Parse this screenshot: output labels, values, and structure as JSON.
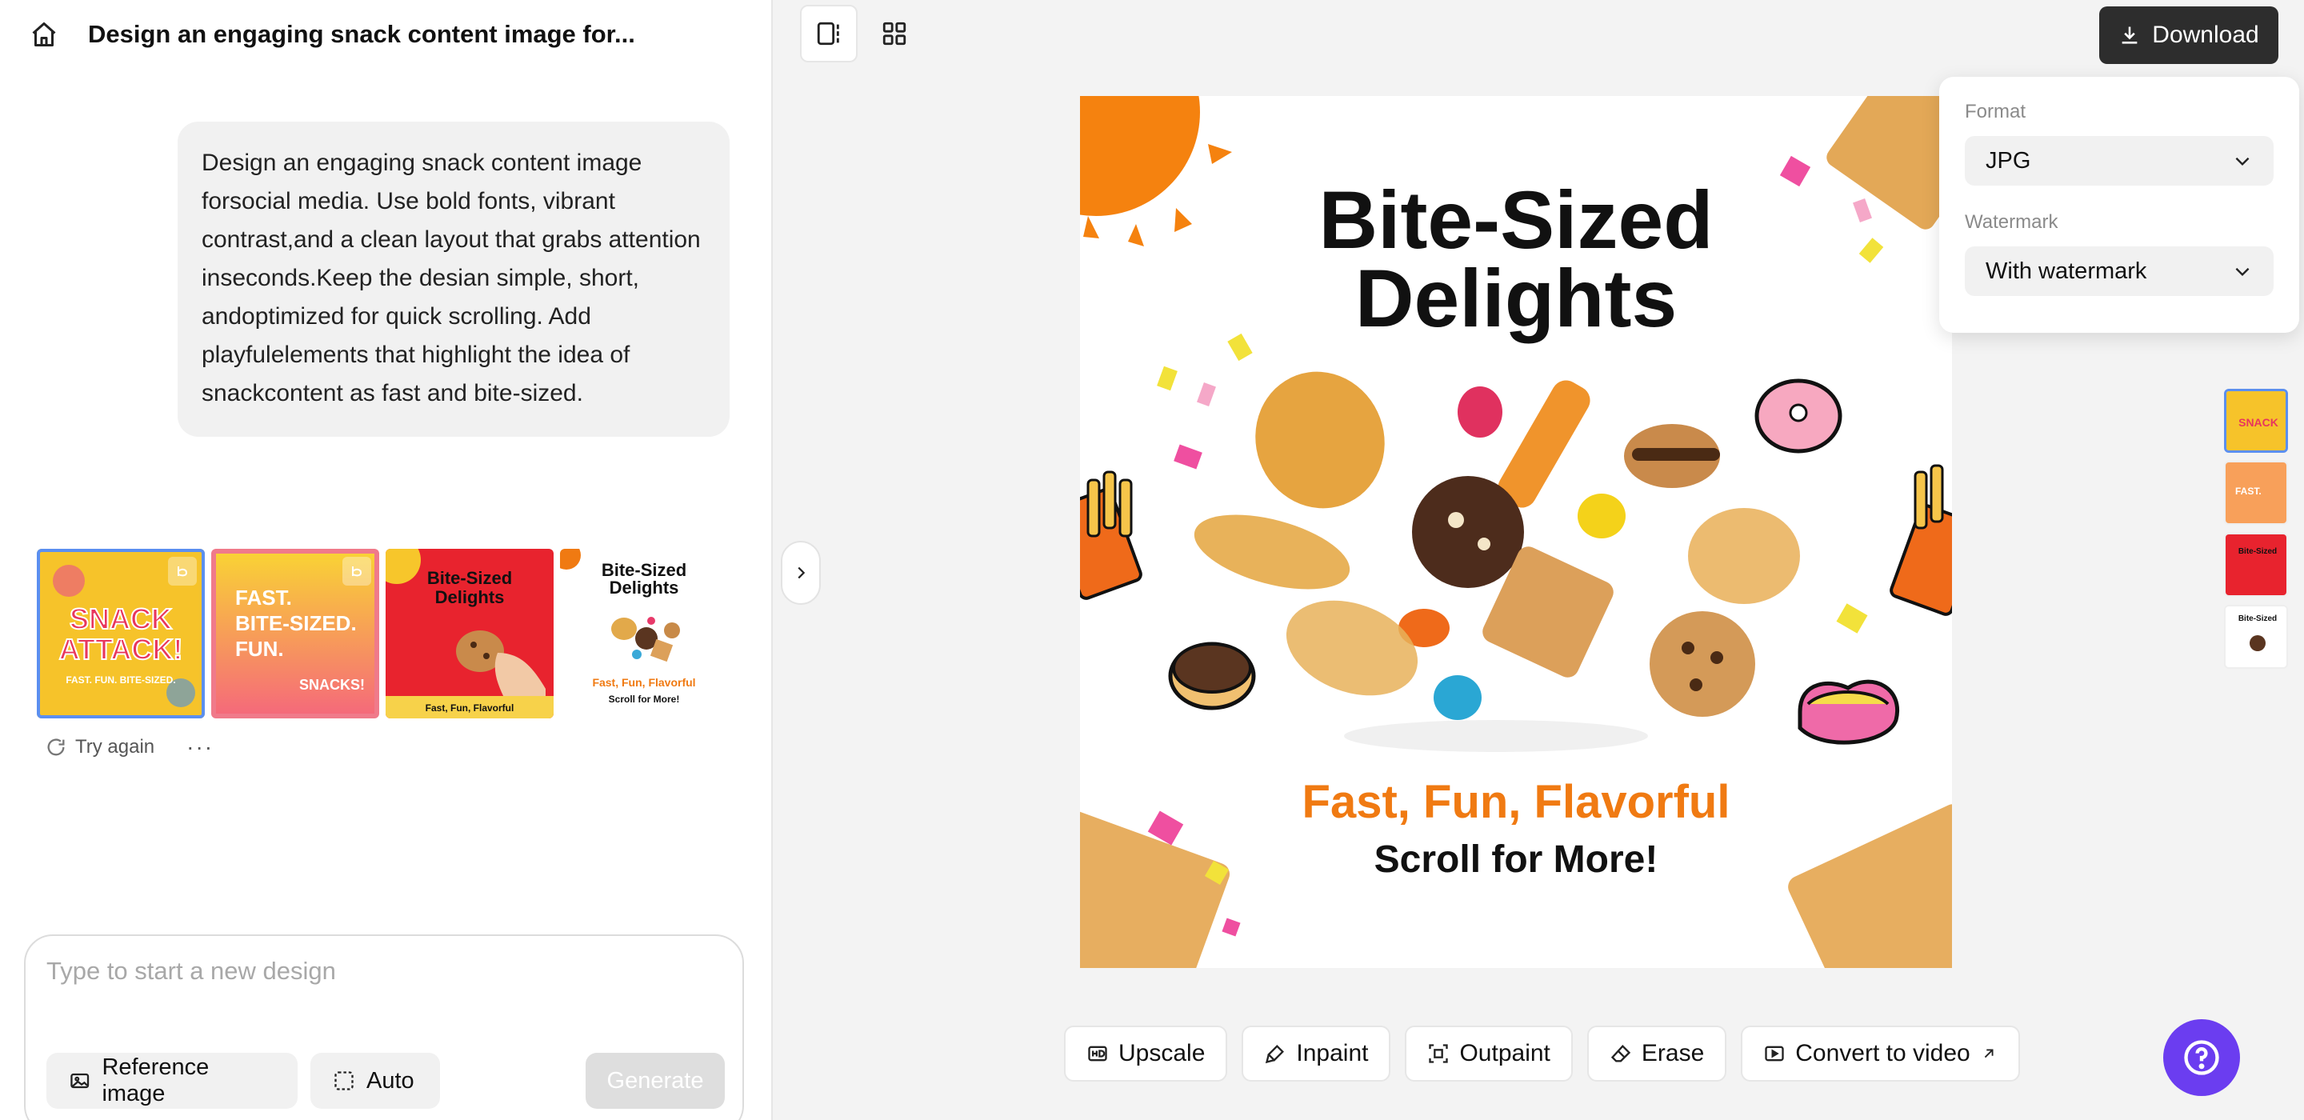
{
  "header": {
    "title": "Design an engaging snack content image for..."
  },
  "prompt": {
    "text": "Design an engaging snack content image forsocial media. Use bold fonts, vibrant contrast,and a clean layout that grabs attention inseconds.Keep the desian simple, short, andoptimized for quick scrolling. Add playfulelements that highlight the idea of snackcontent as fast and bite-sized."
  },
  "thumbnails": [
    {
      "title": "SNACK ATTACK!",
      "sub": "FAST. FUN. BITE-SIZED."
    },
    {
      "title": "FAST. BITE-SIZED. FUN.",
      "sub": "SNACKS!"
    },
    {
      "title": "Bite-Sized Delights",
      "sub": "Fast, Fun, Flavorful"
    },
    {
      "title": "Bite-Sized Delights",
      "sub": "Fast, Fun, Flavorful",
      "sub2": "Scroll for More!"
    }
  ],
  "actions": {
    "try_again": "Try again",
    "more": "···"
  },
  "composer": {
    "placeholder": "Type to start a new design",
    "reference_label": "Reference image",
    "auto_label": "Auto",
    "generate_label": "Generate"
  },
  "download": {
    "label": "Download"
  },
  "dropdown": {
    "format_label": "Format",
    "format_value": "JPG",
    "watermark_label": "Watermark",
    "watermark_value": "With watermark"
  },
  "canvas": {
    "title_line1": "Bite-Sized",
    "title_line2": "Delights",
    "tagline": "Fast, Fun, Flavorful",
    "cta": "Scroll for More!",
    "accent": "#f07a12"
  },
  "toolbar": {
    "upscale": "Upscale",
    "inpaint": "Inpaint",
    "outpaint": "Outpaint",
    "erase": "Erase",
    "convert": "Convert to video"
  },
  "colors": {
    "help": "#6b3df0",
    "selection": "#5b8ff0",
    "download_bg": "#2d2d2d"
  }
}
